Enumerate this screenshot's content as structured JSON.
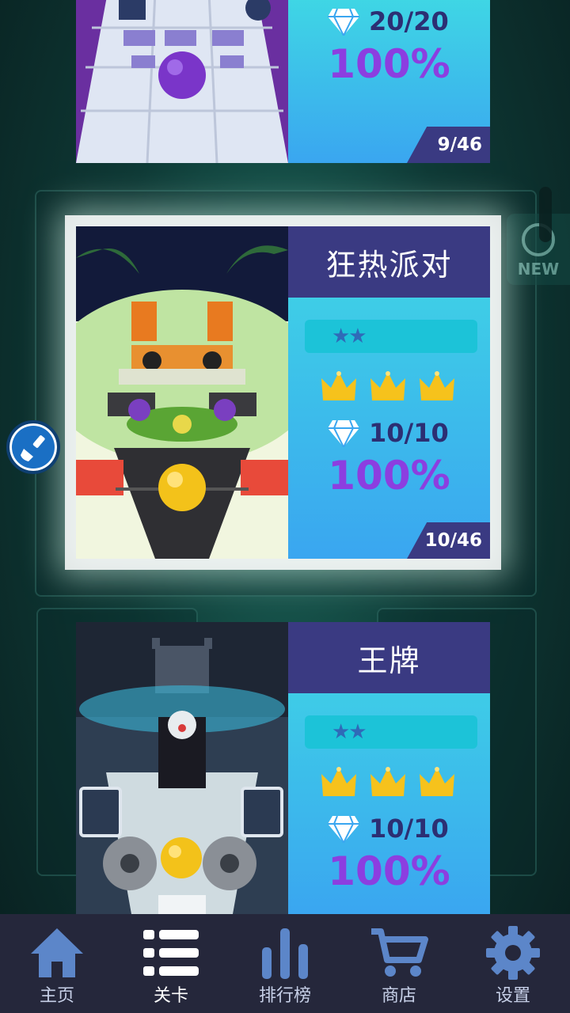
{
  "levels": [
    {
      "title": "",
      "gems": "20/20",
      "percent": "100%",
      "index": "9/46"
    },
    {
      "title": "狂热派对",
      "stars": "★★",
      "gems": "10/10",
      "percent": "100%",
      "index": "10/46"
    },
    {
      "title": "王牌",
      "stars": "★★",
      "gems": "10/10",
      "percent": "100%",
      "index": ""
    }
  ],
  "background": {
    "new_badge": "NEW"
  },
  "tabs": [
    {
      "label": "主页",
      "icon": "home-icon"
    },
    {
      "label": "关卡",
      "icon": "list-icon"
    },
    {
      "label": "排行榜",
      "icon": "leaderboard-icon"
    },
    {
      "label": "商店",
      "icon": "cart-icon"
    },
    {
      "label": "设置",
      "icon": "gear-icon"
    }
  ],
  "active_tab": "关卡",
  "colors": {
    "title_bar": "#3a3a82",
    "percent": "#8c3ee0",
    "tab_bar": "#25273b",
    "tab_icon": "#5c86c9"
  }
}
